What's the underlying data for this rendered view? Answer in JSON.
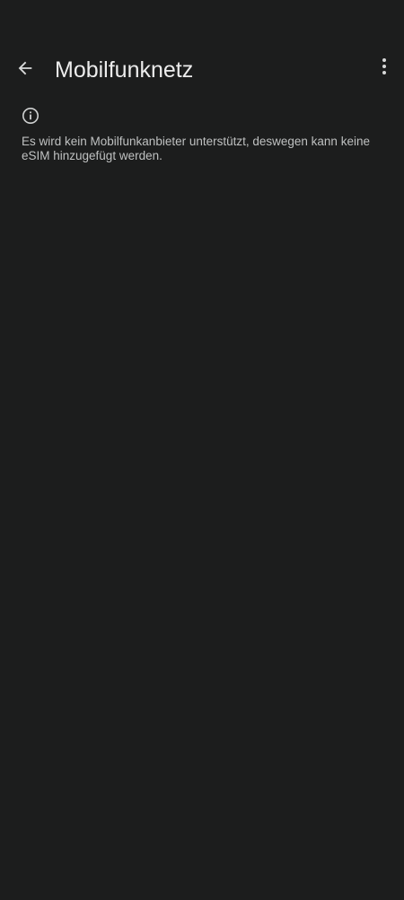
{
  "app_bar": {
    "title": "Mobilfunknetz",
    "back_icon": "arrow-left-icon",
    "overflow_icon": "more-vertical-icon"
  },
  "info": {
    "icon": "info-icon",
    "text": "Es wird kein Mobilfunkanbieter unterstützt, deswegen kann keine eSIM hinzugefügt werden."
  },
  "colors": {
    "background": "#1c1d1d",
    "title": "#ececec",
    "body_text": "#bfc1c1",
    "icon": "#cfd1d1"
  }
}
